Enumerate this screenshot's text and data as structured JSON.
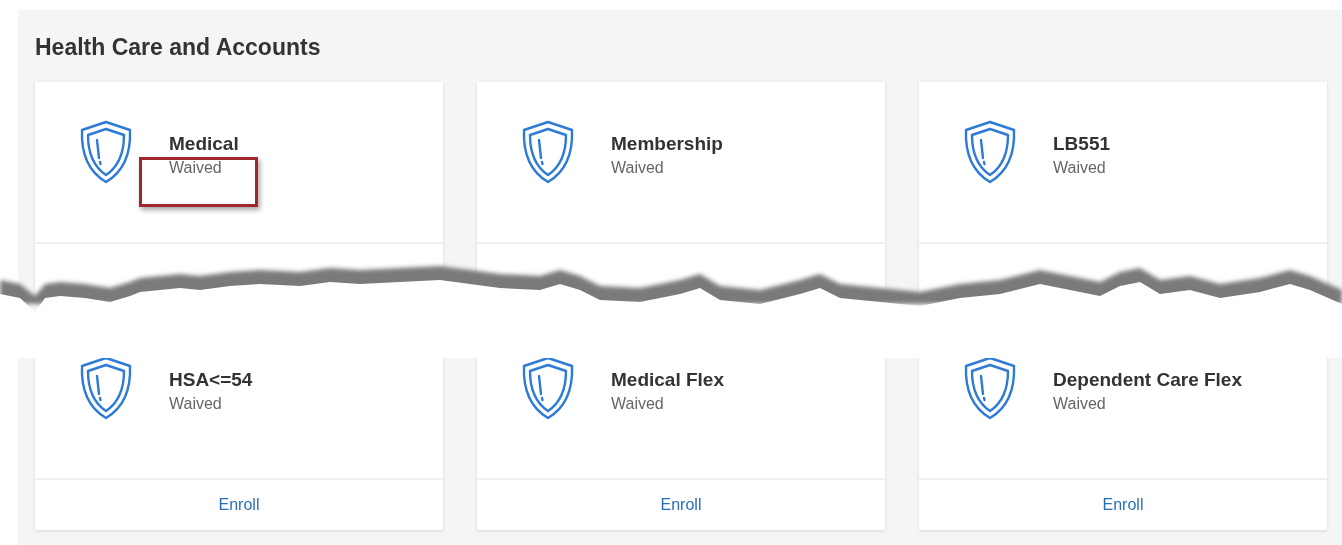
{
  "section": {
    "title": "Health Care and Accounts"
  },
  "cards": [
    {
      "title": "Medical",
      "status": "Waived",
      "highlighted": true
    },
    {
      "title": "Membership",
      "status": "Waived",
      "highlighted": false
    },
    {
      "title": "LB551",
      "status": "Waived",
      "highlighted": false
    },
    {
      "title": "HSA<=54",
      "status": "Waived",
      "highlighted": false,
      "action": "Enroll"
    },
    {
      "title": "Medical Flex",
      "status": "Waived",
      "highlighted": false,
      "action": "Enroll"
    },
    {
      "title": "Dependent Care Flex",
      "status": "Waived",
      "highlighted": false,
      "action": "Enroll"
    }
  ]
}
